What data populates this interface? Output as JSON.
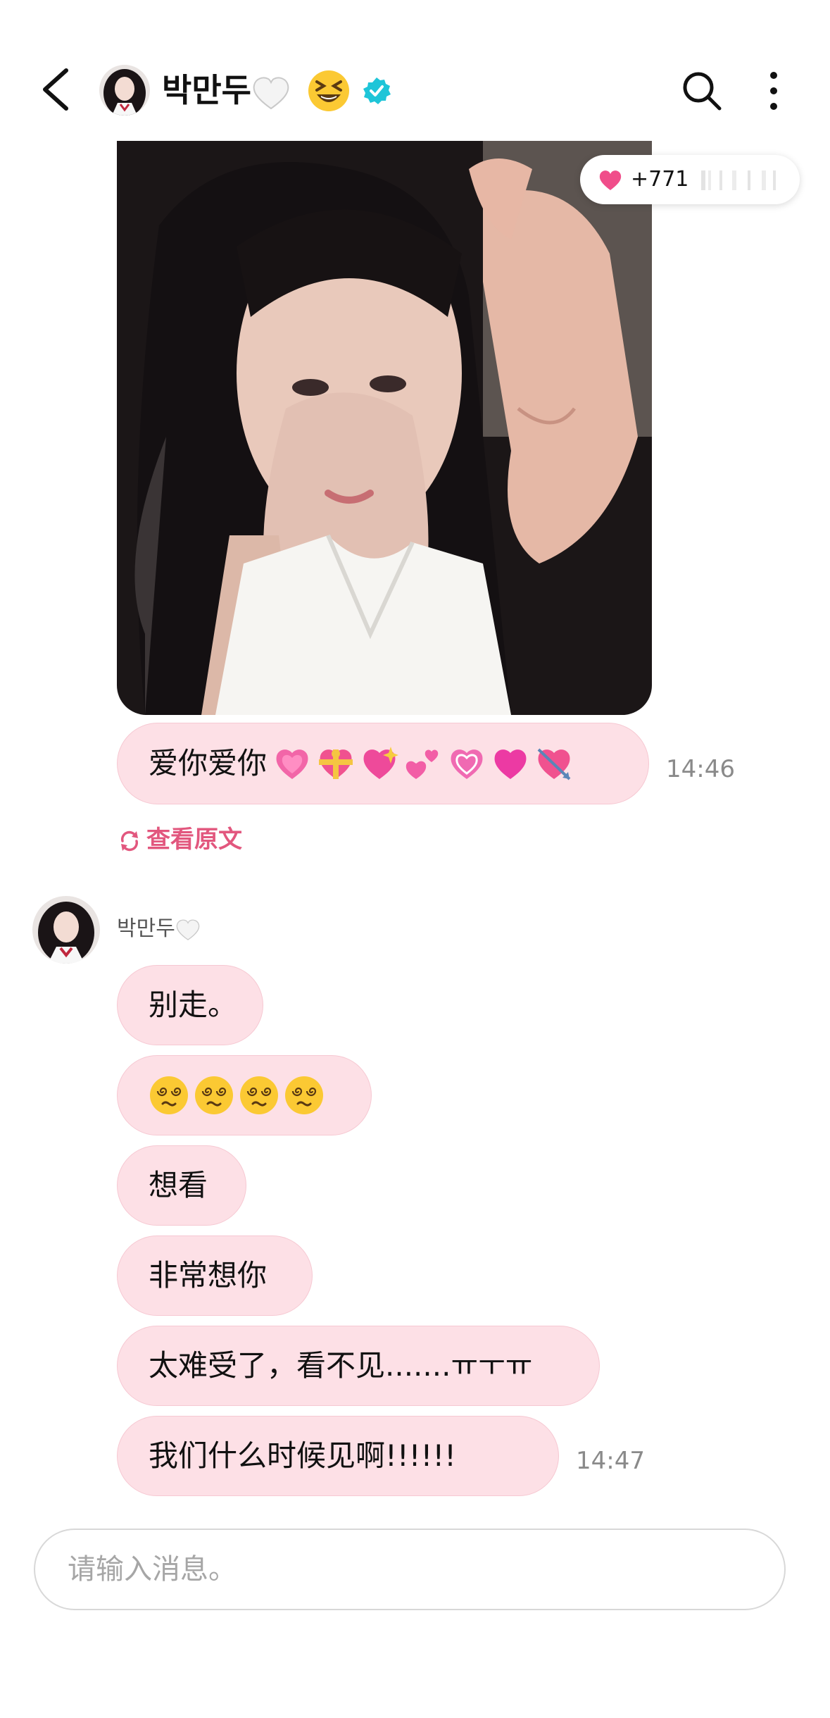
{
  "header": {
    "name": "박만두",
    "heart_icon": "white-heart-icon",
    "emoji": "grinning-squinting-face",
    "verified_icon": "verified-badge-icon",
    "accent_color": "#1ec5d8"
  },
  "photo_post": {
    "like_count": "+771"
  },
  "messages_top": {
    "text": "爱你爱你",
    "emojis": [
      "growing-heart",
      "heart-with-ribbon",
      "sparkling-heart",
      "two-hearts",
      "beating-heart",
      "pink-heart",
      "heart-with-arrow"
    ],
    "time": "14:46"
  },
  "view_original": "查看原文",
  "sender": {
    "name": "박만두"
  },
  "messages": [
    {
      "text": "别走。"
    },
    {
      "text": ""
    },
    {
      "text": "想看"
    },
    {
      "text": "非常想你"
    },
    {
      "text": "太难受了，看不见.......ㅠㅜㅠ"
    },
    {
      "text": "我们什么时候见啊!!!!!!"
    }
  ],
  "last_time": "14:47",
  "composer": {
    "placeholder": "请输入消息。"
  },
  "colors": {
    "bubble_bg": "#fde0e6",
    "accent_pink": "#e2577e"
  }
}
